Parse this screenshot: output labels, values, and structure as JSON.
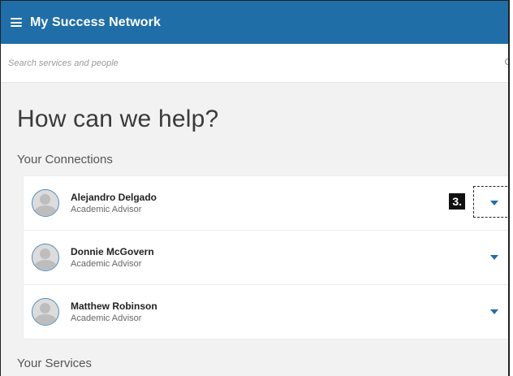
{
  "header": {
    "app_title": "My Success Network"
  },
  "search": {
    "placeholder": "Search services and people"
  },
  "main": {
    "headline": "How can we help?",
    "connections_title": "Your Connections",
    "connections": [
      {
        "name": "Alejandro Delgado",
        "role": "Academic Advisor"
      },
      {
        "name": "Donnie McGovern",
        "role": "Academic Advisor"
      },
      {
        "name": "Matthew Robinson",
        "role": "Academic Advisor"
      }
    ],
    "next_section_title": "Your Services"
  },
  "annotation": {
    "step_label": "3."
  },
  "colors": {
    "brand": "#1f6ea8",
    "avatar_ring": "#4b8fc4"
  },
  "icons": [
    "menu-icon",
    "search-icon",
    "avatar-icon",
    "chevron-down-icon"
  ]
}
